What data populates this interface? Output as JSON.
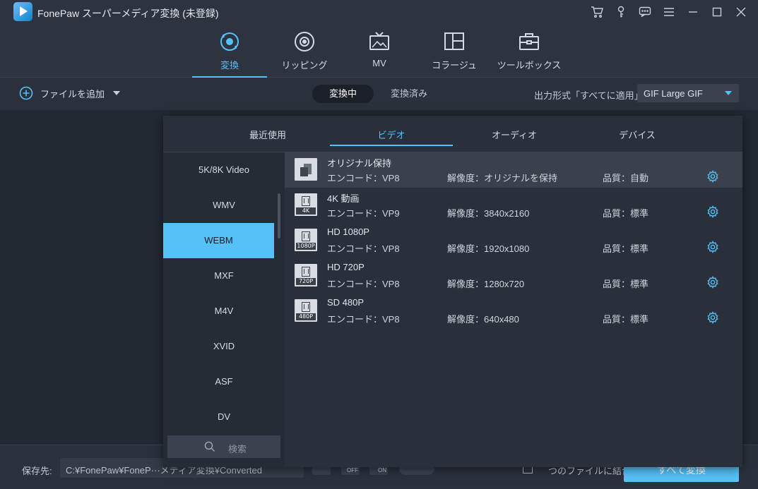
{
  "titlebar": {
    "title": "FonePaw スーパーメディア変換 (未登録)",
    "controls": [
      "cart-icon",
      "key-icon",
      "chat-icon",
      "menu-icon",
      "minimize-icon",
      "maximize-icon",
      "close-icon"
    ]
  },
  "nav": {
    "tabs": [
      {
        "label": "変換",
        "icon": "convert-icon",
        "active": true
      },
      {
        "label": "リッピング",
        "icon": "disc-icon",
        "active": false
      },
      {
        "label": "MV",
        "icon": "tv-icon",
        "active": false
      },
      {
        "label": "コラージュ",
        "icon": "collage-icon",
        "active": false
      },
      {
        "label": "ツールボックス",
        "icon": "toolbox-icon",
        "active": false
      }
    ]
  },
  "toolbar": {
    "add_file": "ファイルを追加",
    "seg_converting": "変換中",
    "seg_converted": "変換済み",
    "output_label": "出力形式「すべてに適用」:",
    "output_value": "GIF Large GIF"
  },
  "bottom": {
    "save_label": "保存先:",
    "save_path": "C:¥FonePaw¥FoneP···メディア変換¥Converted",
    "merge_label": "つのファイルに結合",
    "convert_all": "すべて変換",
    "icon_off": "OFF",
    "icon_on": "ON"
  },
  "popup": {
    "tabs": [
      "最近使用",
      "ビデオ",
      "オーディオ",
      "デバイス"
    ],
    "active_tab": 1,
    "categories": [
      "5K/8K Video",
      "WMV",
      "WEBM",
      "MXF",
      "M4V",
      "XVID",
      "ASF",
      "DV"
    ],
    "active_category": 2,
    "search_placeholder": "検索",
    "formats": [
      {
        "name": "オリジナル保持",
        "encode": "エンコード：VP8",
        "resolution": "解像度：オリジナルを保持",
        "quality": "品質：自動",
        "tag": ""
      },
      {
        "name": "4K 動画",
        "encode": "エンコード：VP9",
        "resolution": "解像度：3840x2160",
        "quality": "品質：標準",
        "tag": "4K"
      },
      {
        "name": "HD 1080P",
        "encode": "エンコード：VP8",
        "resolution": "解像度：1920x1080",
        "quality": "品質：標準",
        "tag": "1080P"
      },
      {
        "name": "HD 720P",
        "encode": "エンコード：VP8",
        "resolution": "解像度：1280x720",
        "quality": "品質：標準",
        "tag": "720P"
      },
      {
        "name": "SD 480P",
        "encode": "エンコード：VP8",
        "resolution": "解像度：640x480",
        "quality": "品質：標準",
        "tag": "480P"
      }
    ]
  },
  "colors": {
    "accent": "#56c1f7",
    "background": "#232933",
    "panel": "#2d3440"
  }
}
